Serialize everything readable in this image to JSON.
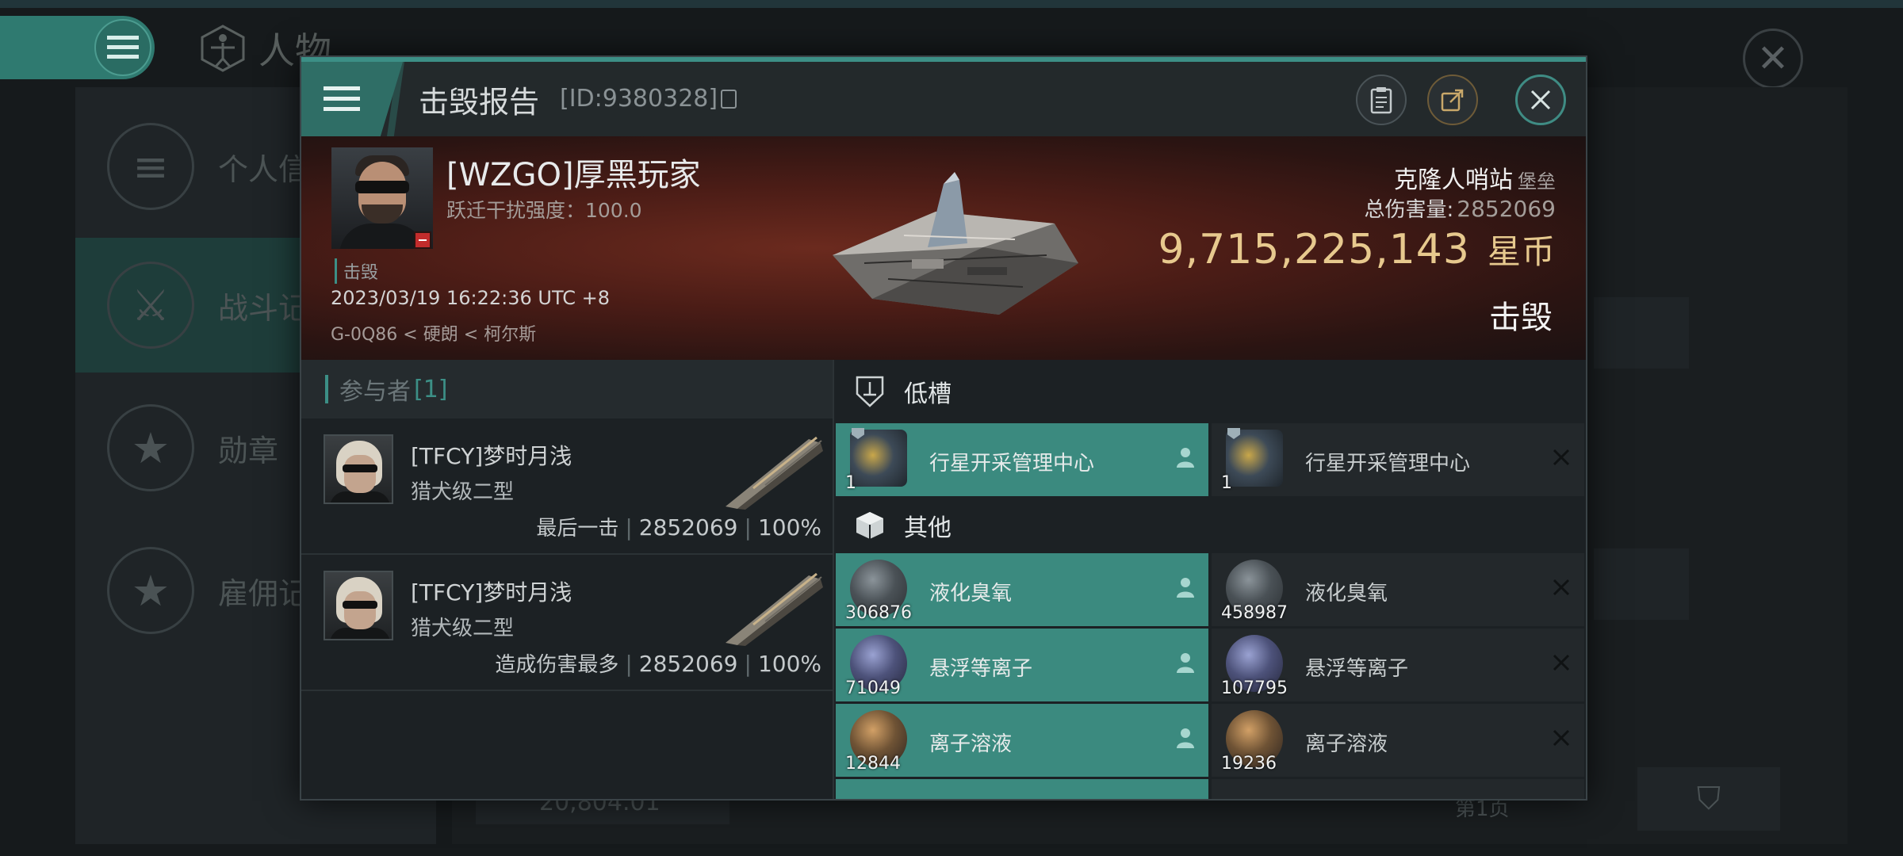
{
  "background": {
    "page_title": "人物",
    "sidebar": [
      {
        "label": "个人信",
        "icon": "list-icon"
      },
      {
        "label": "战斗记",
        "icon": "crossed-swords-icon",
        "active": true
      },
      {
        "label": "勋章",
        "icon": "star-badge-icon"
      },
      {
        "label": "雇佣记",
        "icon": "star-wreath-icon"
      }
    ],
    "bottom_value": "20,804.01",
    "page_label": "第1页"
  },
  "dialog": {
    "title": "击毁报告",
    "id_text": "[ID:9380328]",
    "victim": {
      "name": "[WZGO]厚黑玩家",
      "warp_text": "跃迁干扰强度：100.0",
      "tag": "击毁",
      "time": "2023/03/19 16:22:36 UTC +8",
      "location": "G-0Q86 < 硬朗 < 柯尔斯"
    },
    "structure": {
      "name": "克隆人哨站",
      "type": "堡垒",
      "total_damage_label": "总伤害量:",
      "total_damage": "2852069",
      "value": "9,715,225,143",
      "currency": "星币",
      "status": "击毁"
    },
    "participants": {
      "header_label": "参与者",
      "count": "[1]",
      "rows": [
        {
          "name": "[TFCY]梦时月浅",
          "ship": "猎犬级二型",
          "label": "最后一击",
          "damage": "2852069",
          "percent": "100%"
        },
        {
          "name": "[TFCY]梦时月浅",
          "ship": "猎犬级二型",
          "label": "造成伤害最多",
          "damage": "2852069",
          "percent": "100%"
        }
      ]
    },
    "sections": [
      {
        "title": "低槽",
        "icon": "low-slot-icon"
      },
      {
        "title": "其他",
        "icon": "cargo-box-icon"
      }
    ],
    "low_slot_items": [
      {
        "name": "行星开采管理中心",
        "qty": "1",
        "state": "dropped"
      },
      {
        "name": "行星开采管理中心",
        "qty": "1",
        "state": "destroyed"
      }
    ],
    "other_items": [
      {
        "name": "液化臭氧",
        "qty": "306876",
        "state": "dropped",
        "thumb": "gray"
      },
      {
        "name": "液化臭氧",
        "qty": "458987",
        "state": "destroyed",
        "thumb": "gray"
      },
      {
        "name": "悬浮等离子",
        "qty": "71049",
        "state": "dropped",
        "thumb": "blue"
      },
      {
        "name": "悬浮等离子",
        "qty": "107795",
        "state": "destroyed",
        "thumb": "blue"
      },
      {
        "name": "离子溶液",
        "qty": "12844",
        "state": "dropped",
        "thumb": "orange"
      },
      {
        "name": "离子溶液",
        "qty": "19236",
        "state": "destroyed",
        "thumb": "orange"
      }
    ]
  }
}
